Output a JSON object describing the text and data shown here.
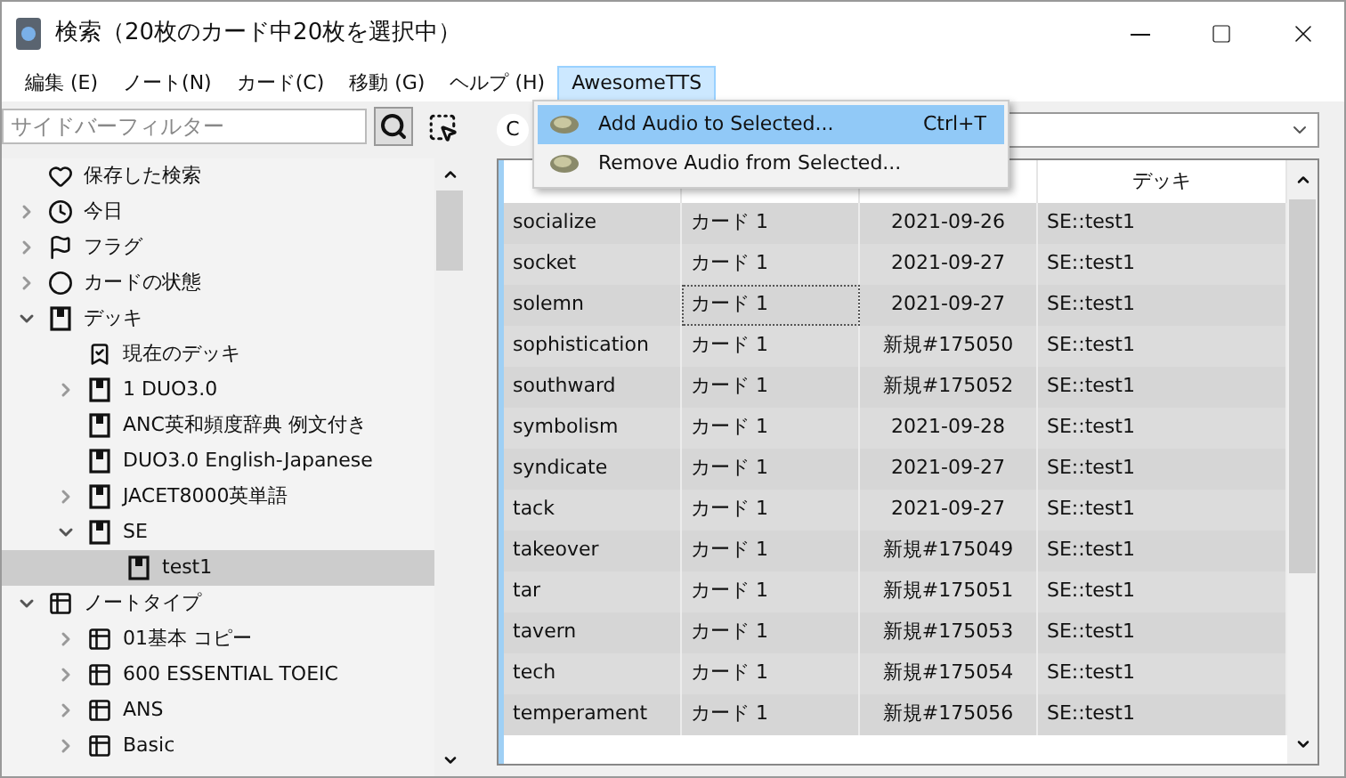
{
  "window": {
    "title": "検索（20枚のカード中20枚を選択中）"
  },
  "menu_bar": [
    {
      "label": "編集 (E)",
      "selected": false
    },
    {
      "label": "ノート(N)",
      "selected": false
    },
    {
      "label": "カード(C)",
      "selected": false
    },
    {
      "label": "移動 (G)",
      "selected": false
    },
    {
      "label": "ヘルプ (H)",
      "selected": false
    },
    {
      "label": "AwesomeTTS",
      "selected": true
    }
  ],
  "dropdown_menu": [
    {
      "label": "Add Audio to Selected...",
      "shortcut": "Ctrl+T",
      "selected": true
    },
    {
      "label": "Remove Audio from Selected...",
      "selected": false
    }
  ],
  "sidebar": {
    "filter": {
      "placeholder": "サイドバーフィルター"
    },
    "tree": [
      {
        "label": "保存した検索",
        "kind": "heart",
        "selected": false
      },
      {
        "label": "今日",
        "kind": "clock",
        "expanded": false,
        "selected": false
      },
      {
        "label": "フラグ",
        "kind": "flag",
        "expanded": false,
        "selected": false
      },
      {
        "label": "カードの状態",
        "kind": "circle",
        "expanded": false,
        "selected": false
      },
      {
        "label": "デッキ",
        "kind": "deck",
        "expanded": true,
        "selected": false,
        "children": [
          {
            "label": "現在のデッキ",
            "kind": "current",
            "selected": false
          },
          {
            "label": "1 DUO3.0",
            "kind": "deck",
            "expanded": false,
            "selected": false
          },
          {
            "label": "ANC英和頻度辞典 例文付き",
            "kind": "deck",
            "selected": false
          },
          {
            "label": "DUO3.0 English-Japanese",
            "kind": "deck",
            "selected": false
          },
          {
            "label": "JACET8000英単語",
            "kind": "deck",
            "expanded": false,
            "selected": false
          },
          {
            "label": "SE",
            "kind": "deck",
            "expanded": true,
            "selected": false,
            "children": [
              {
                "label": "test1",
                "kind": "deck",
                "selected": true
              }
            ]
          }
        ]
      },
      {
        "label": "ノートタイプ",
        "kind": "notetype",
        "expanded": true,
        "selected": false,
        "children": [
          {
            "label": "01基本 コピー",
            "kind": "notetype",
            "expanded": false,
            "selected": false
          },
          {
            "label": "600 ESSENTIAL TOEIC",
            "kind": "notetype",
            "expanded": false,
            "selected": false
          },
          {
            "label": "ANS",
            "kind": "notetype",
            "expanded": false,
            "selected": false
          },
          {
            "label": "Basic",
            "kind": "notetype",
            "expanded": false,
            "selected": false
          }
        ]
      }
    ]
  },
  "toggle": {
    "label": "C"
  },
  "table": {
    "columns": [
      {},
      {},
      {},
      {
        "label": "デッキ"
      }
    ],
    "rows": [
      {
        "cells": [
          "socialize",
          "カード 1",
          "2021-09-26",
          "SE::test1"
        ],
        "selected": true,
        "focused": false
      },
      {
        "cells": [
          "socket",
          "カード 1",
          "2021-09-27",
          "SE::test1"
        ],
        "selected": true,
        "focused": false
      },
      {
        "cells": [
          "solemn",
          "カード 1",
          "2021-09-27",
          "SE::test1"
        ],
        "selected": true,
        "focused": true
      },
      {
        "cells": [
          "sophistication",
          "カード 1",
          "新規#175050",
          "SE::test1"
        ],
        "selected": true,
        "focused": false
      },
      {
        "cells": [
          "southward",
          "カード 1",
          "新規#175052",
          "SE::test1"
        ],
        "selected": true,
        "focused": false
      },
      {
        "cells": [
          "symbolism",
          "カード 1",
          "2021-09-28",
          "SE::test1"
        ],
        "selected": true,
        "focused": false
      },
      {
        "cells": [
          "syndicate",
          "カード 1",
          "2021-09-27",
          "SE::test1"
        ],
        "selected": true,
        "focused": false
      },
      {
        "cells": [
          "tack",
          "カード 1",
          "2021-09-27",
          "SE::test1"
        ],
        "selected": true,
        "focused": false
      },
      {
        "cells": [
          "takeover",
          "カード 1",
          "新規#175049",
          "SE::test1"
        ],
        "selected": true,
        "focused": false
      },
      {
        "cells": [
          "tar",
          "カード 1",
          "新規#175051",
          "SE::test1"
        ],
        "selected": true,
        "focused": false
      },
      {
        "cells": [
          "tavern",
          "カード 1",
          "新規#175053",
          "SE::test1"
        ],
        "selected": true,
        "focused": false
      },
      {
        "cells": [
          "tech",
          "カード 1",
          "新規#175054",
          "SE::test1"
        ],
        "selected": true,
        "focused": false
      },
      {
        "cells": [
          "temperament",
          "カード 1",
          "新規#175056",
          "SE::test1"
        ],
        "selected": true,
        "focused": false
      }
    ]
  }
}
